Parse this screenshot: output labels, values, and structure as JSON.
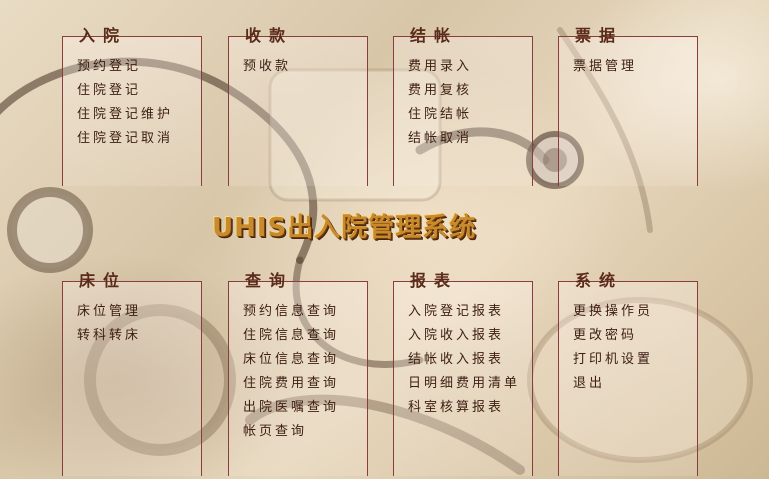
{
  "app_title": "UHIS出入院管理系统",
  "panels": [
    {
      "title": "入院",
      "items": [
        "预约登记",
        "住院登记",
        "住院登记维护",
        "住院登记取消"
      ]
    },
    {
      "title": "收款",
      "items": [
        "预收款"
      ]
    },
    {
      "title": "结帐",
      "items": [
        "费用录入",
        "费用复核",
        "住院结帐",
        "结帐取消"
      ]
    },
    {
      "title": "票据",
      "items": [
        "票据管理"
      ]
    },
    {
      "title": "床位",
      "items": [
        "床位管理",
        "转科转床"
      ]
    },
    {
      "title": "查询",
      "items": [
        "预约信息查询",
        "住院信息查询",
        "床位信息查询",
        "住院费用查询",
        "出院医嘱查询",
        "帐页查询"
      ]
    },
    {
      "title": "报表",
      "items": [
        "入院登记报表",
        "入院收入报表",
        "结帐收入报表",
        "日明细费用清单",
        "科室核算报表"
      ]
    },
    {
      "title": "系统",
      "items": [
        "更换操作员",
        "更改密码",
        "打印机设置",
        "退出"
      ]
    }
  ],
  "colors": {
    "panel_border": "#8a3d3d",
    "title_text": "#5a2a1a",
    "item_text": "#3d1d12",
    "logo": "#c98a2c"
  }
}
